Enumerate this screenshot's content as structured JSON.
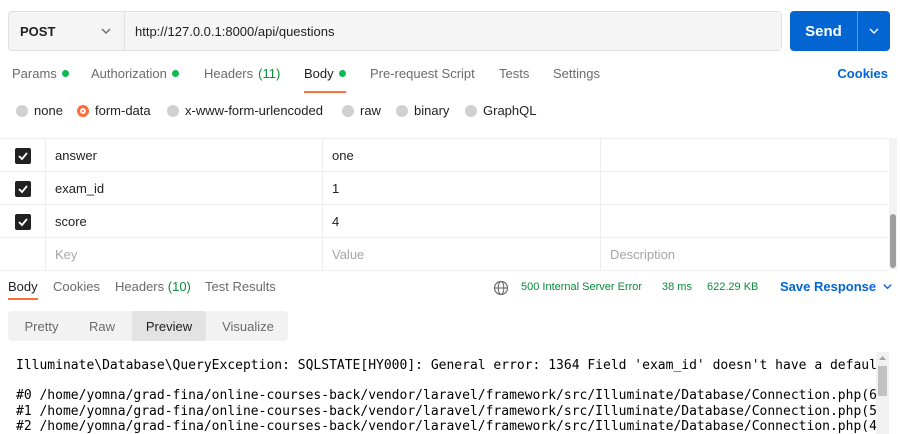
{
  "request": {
    "method": "POST",
    "url": "http://127.0.0.1:8000/api/questions",
    "send_label": "Send"
  },
  "request_tabs": {
    "params": "Params",
    "authorization": "Authorization",
    "headers": "Headers",
    "headers_count": "(11)",
    "body": "Body",
    "pre_request": "Pre-request Script",
    "tests": "Tests",
    "settings": "Settings",
    "cookies": "Cookies"
  },
  "body_types": {
    "none": "none",
    "form_data": "form-data",
    "urlencoded": "x-www-form-urlencoded",
    "raw": "raw",
    "binary": "binary",
    "graphql": "GraphQL",
    "selected": "form-data"
  },
  "params": {
    "rows": [
      {
        "key": "answer",
        "value": "one",
        "checked": true
      },
      {
        "key": "exam_id",
        "value": "1",
        "checked": true
      },
      {
        "key": "score",
        "value": "4",
        "checked": true
      }
    ],
    "placeholder": {
      "key": "Key",
      "value": "Value",
      "description": "Description"
    }
  },
  "response_tabs": {
    "body": "Body",
    "cookies": "Cookies",
    "headers": "Headers",
    "headers_count": "(10)",
    "test_results": "Test Results"
  },
  "response_status": {
    "status": "500 Internal Server Error",
    "time": "38 ms",
    "size": "622.29 KB",
    "save_label": "Save Response"
  },
  "view_modes": {
    "pretty": "Pretty",
    "raw": "Raw",
    "preview": "Preview",
    "visualize": "Visualize",
    "selected": "Preview"
  },
  "preview_lines": {
    "l0": "Illuminate\\Database\\QueryException: SQLSTATE[HY000]: General error: 1364 Field 'exam_id' doesn't have a default",
    "l1": "#0 /home/yomna/grad-fina/online-courses-back/vendor/laravel/framework/src/Illuminate/Database/Connection.php(6",
    "l2": "#1 /home/yomna/grad-fina/online-courses-back/vendor/laravel/framework/src/Illuminate/Database/Connection.php(5",
    "l3": "#2 /home/yomna/grad-fina/online-courses-back/vendor/laravel/framework/src/Illuminate/Database/Connection.php(4"
  },
  "colors": {
    "accent": "#ff6c37",
    "primary": "#0265d2",
    "success": "#0cbb52"
  }
}
